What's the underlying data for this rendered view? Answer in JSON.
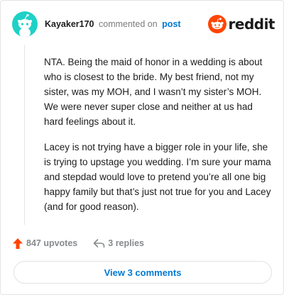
{
  "comment": {
    "username": "Kayaker170",
    "action_text": "commented on",
    "post_link": "post",
    "avatar_color": "#1fd1c6",
    "avatar_icon": "snoo-avatar-icon",
    "paragraphs": [
      "NTA. Being the maid of honor in a wedding is about who is closest to the bride. My best friend, not my sister, was my MOH, and I wasn’t my sister’s MOH. We were never super close and neither at us had hard feelings about it.",
      "Lacey is not trying have a bigger role in your life, she is trying to upstage you wedding. I’m sure your mama and stepdad would love to pretend you’re all one big happy family but that’s just not true for you and Lacey (and for good reason)."
    ]
  },
  "brand": {
    "name": "reddit",
    "logo_icon": "reddit-snoo-icon",
    "logo_color": "#ff4500"
  },
  "actions": {
    "upvotes_label": "847 upvotes",
    "replies_label": "3 replies",
    "upvote_icon": "upvote-arrow-icon",
    "upvote_color": "#ff4500",
    "reply_icon": "reply-arrow-icon"
  },
  "footer": {
    "view_comments_label": "View 3 comments",
    "link_color": "#0079d3"
  }
}
